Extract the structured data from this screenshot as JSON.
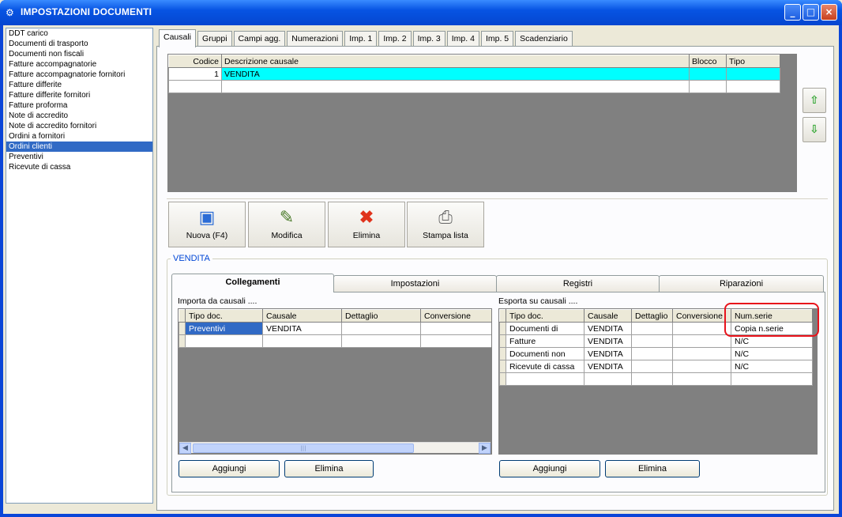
{
  "window": {
    "title": "IMPOSTAZIONI DOCUMENTI",
    "minimize": "_",
    "maximize": "□",
    "close": "×"
  },
  "sidebar": {
    "items": [
      "DDT carico",
      "Documenti di trasporto",
      "Documenti non fiscali",
      "Fatture accompagnatorie",
      "Fatture accompagnatorie fornitori",
      "Fatture differite",
      "Fatture differite fornitori",
      "Fatture proforma",
      "Note di accredito",
      "Note di accredito fornitori",
      "Ordini a fornitori",
      "Ordini clienti",
      "Preventivi",
      "Ricevute di cassa"
    ],
    "selected_index": 11
  },
  "tabs": [
    "Causali",
    "Gruppi",
    "Campi agg.",
    "Numerazioni",
    "Imp. 1",
    "Imp. 2",
    "Imp. 3",
    "Imp. 4",
    "Imp. 5",
    "Scadenziario"
  ],
  "causali_grid": {
    "headers": [
      "Codice",
      "Descrizione causale",
      "Blocco",
      "Tipo"
    ],
    "rows": [
      [
        "1",
        "VENDITA",
        "",
        ""
      ]
    ]
  },
  "toolbar": {
    "nuova": "Nuova (F4)",
    "modifica": "Modifica",
    "elimina": "Elimina",
    "stampa": "Stampa lista"
  },
  "group_label": "VENDITA",
  "inner_tabs": [
    "Collegamenti",
    "Impostazioni",
    "Registri",
    "Riparazioni"
  ],
  "importa": {
    "label": "Importa da causali ....",
    "headers": [
      "Tipo doc.",
      "Causale",
      "Dettaglio",
      "Conversione"
    ],
    "rows": [
      [
        "Preventivi",
        "VENDITA",
        "",
        ""
      ]
    ],
    "scroll_thumb": "|||",
    "aggiungi": "Aggiungi",
    "elimina": "Elimina"
  },
  "esporta": {
    "label": "Esporta su causali ....",
    "headers": [
      "Tipo doc.",
      "Causale",
      "Dettaglio",
      "Conversione",
      "Num.serie"
    ],
    "rows": [
      [
        "Documenti di",
        "VENDITA",
        "",
        "",
        "Copia n.serie"
      ],
      [
        "Fatture",
        "VENDITA",
        "",
        "",
        "N/C"
      ],
      [
        "Documenti non",
        "VENDITA",
        "",
        "",
        "N/C"
      ],
      [
        "Ricevute di cassa",
        "VENDITA",
        "",
        "",
        "N/C"
      ]
    ],
    "aggiungi": "Aggiungi",
    "elimina": "Elimina"
  },
  "colors": {
    "selection": "#316ac5",
    "highlight_row": "#00ffff",
    "annotation": "#e8131b",
    "group_label": "#0046d5"
  },
  "icons": {
    "up": "arrow-up-icon",
    "down": "arrow-down-icon"
  }
}
